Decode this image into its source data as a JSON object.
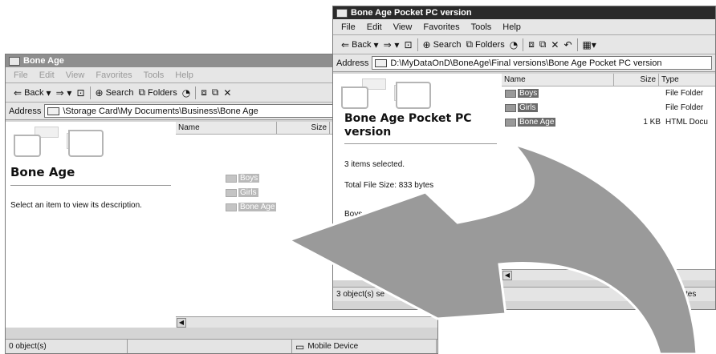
{
  "left_window": {
    "title": "Bone Age",
    "menu": [
      "File",
      "Edit",
      "View",
      "Favorites",
      "Tools",
      "Help"
    ],
    "toolbar": {
      "back": "Back",
      "search": "Search",
      "folders": "Folders"
    },
    "address_label": "Address",
    "address_value": "\\Storage Card\\My Documents\\Business\\Bone Age",
    "folder_heading": "Bone Age",
    "description": "Select an item to view its description.",
    "columns": {
      "name": "Name",
      "size": "Size"
    },
    "files": [
      {
        "name": "Boys"
      },
      {
        "name": "Girls"
      },
      {
        "name": "Bone Age"
      }
    ],
    "status_objects": "0 object(s)",
    "status_zone": "Mobile Device"
  },
  "right_window": {
    "title": "Bone Age Pocket PC version",
    "menu": [
      "File",
      "Edit",
      "View",
      "Favorites",
      "Tools",
      "Help"
    ],
    "toolbar": {
      "back": "Back",
      "search": "Search",
      "folders": "Folders"
    },
    "address_label": "Address",
    "address_value": "D:\\MyDataOnD\\BoneAge\\Final versions\\Bone Age Pocket PC version",
    "folder_heading_line1": "Bone Age Pocket PC",
    "folder_heading_line2": "version",
    "selected_count": "3 items selected.",
    "total_size": "Total File Size: 833 bytes",
    "first_item": "Boys",
    "columns": {
      "name": "Name",
      "size": "Size",
      "type": "Type"
    },
    "files": [
      {
        "name": "Boys",
        "size": "",
        "type": "File Folder"
      },
      {
        "name": "Girls",
        "size": "",
        "type": "File Folder"
      },
      {
        "name": "Bone Age",
        "size": "1 KB",
        "type": "HTML Docu"
      }
    ],
    "status_objects": "3 object(s) se",
    "status_bytes": "ytes"
  },
  "colors": {
    "title_active": "#2a2a2a",
    "title_inactive": "#8e8e8e",
    "arrow": "#9a9a9a"
  }
}
